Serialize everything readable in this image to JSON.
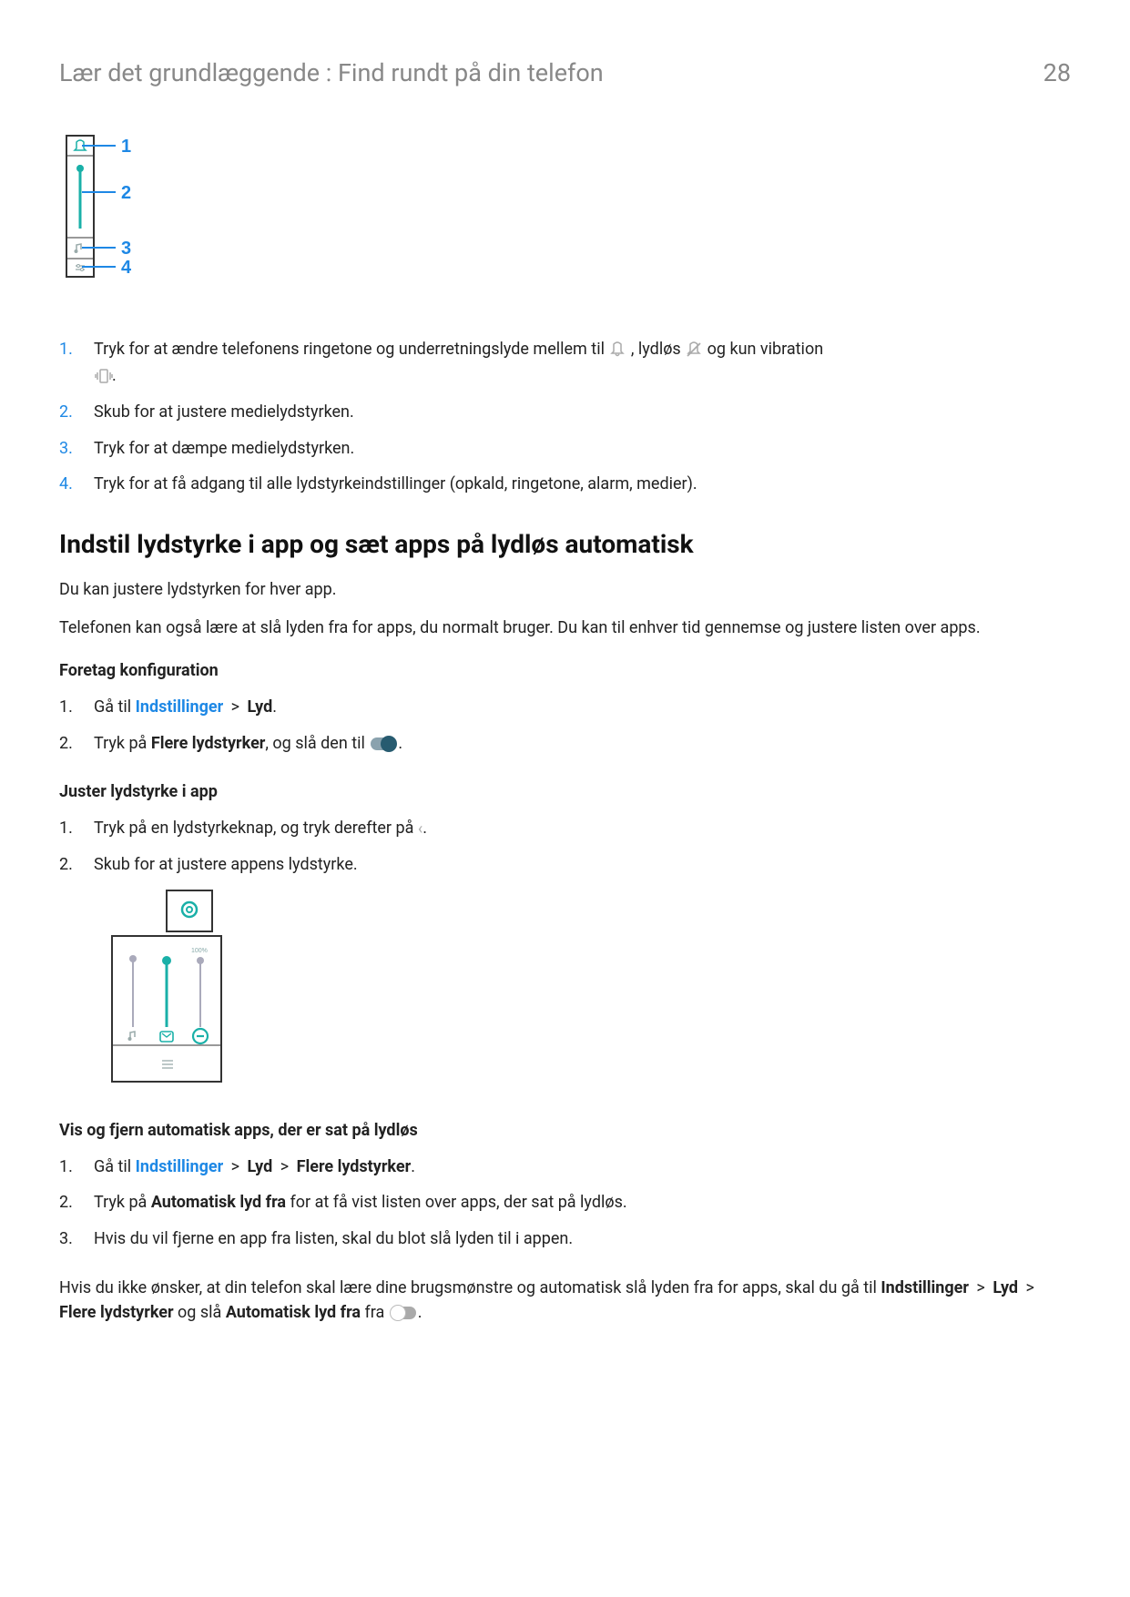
{
  "header": {
    "breadcrumb": "Lær det grundlæggende : Find rundt på din telefon",
    "page_number": "28"
  },
  "blue_list": {
    "i1_p1": "Tryk for at ændre telefonens ringetone og underretningslyde mellem til ",
    "i1_p2": ", lydløs ",
    "i1_p3": " og kun vibration ",
    "i1_p4": ".",
    "i2": "Skub for at justere medielydstyrken.",
    "i3": "Tryk for at dæmpe medielydstyrken.",
    "i4": "Tryk for at få adgang til alle lydstyrkeindstillinger (opkald, ringetone, alarm, medier)."
  },
  "h2_1": "Indstil lydstyrke i app og sæt apps på lydløs automatisk",
  "p1": "Du kan justere lydstyrken for hver app.",
  "p2": "Telefonen kan også lære at slå lyden fra for apps, du normalt bruger. Du kan til enhver tid gennemse og justere listen over apps.",
  "sub1": "Foretag konfiguration",
  "config_list": {
    "i1_p1": "Gå til ",
    "i1_link": "Indstillinger",
    "i1_gt": " > ",
    "i1_b": "Lyd",
    "i1_end": ".",
    "i2_p1": "Tryk på ",
    "i2_b": "Flere lydstyrker",
    "i2_p2": ", og slå den til ",
    "i2_end": "."
  },
  "sub2": "Juster lydstyrke i app",
  "adjust_list": {
    "i1_p1": "Tryk på en lydstyrkeknap, og tryk derefter på ",
    "i1_end": ".",
    "i2": "Skub for at justere appens lydstyrke."
  },
  "sub3": "Vis og fjern automatisk apps, der er sat på lydløs",
  "view_list": {
    "i1_p1": "Gå til ",
    "i1_link": "Indstillinger",
    "i1_gt1": " > ",
    "i1_b1": "Lyd",
    "i1_gt2": " > ",
    "i1_b2": "Flere lydstyrker",
    "i1_end": ".",
    "i2_p1": "Tryk på ",
    "i2_b": "Automatisk lyd fra",
    "i2_p2": " for at få vist listen over apps, der sat på lydløs.",
    "i3": "Hvis du vil fjerne en app fra listen, skal du blot slå lyden til i appen."
  },
  "p3_p1": "Hvis du ikke ønsker, at din telefon skal lære dine brugsmønstre og automatisk slå lyden fra for apps, skal du gå til ",
  "p3_b1": "Indstillinger",
  "p3_gt1": " > ",
  "p3_b2": "Lyd",
  "p3_gt2": " > ",
  "p3_b3": "Flere lydstyrker",
  "p3_p2": " og slå ",
  "p3_b4": "Automatisk lyd fra",
  "p3_p3": " fra ",
  "p3_end": "."
}
